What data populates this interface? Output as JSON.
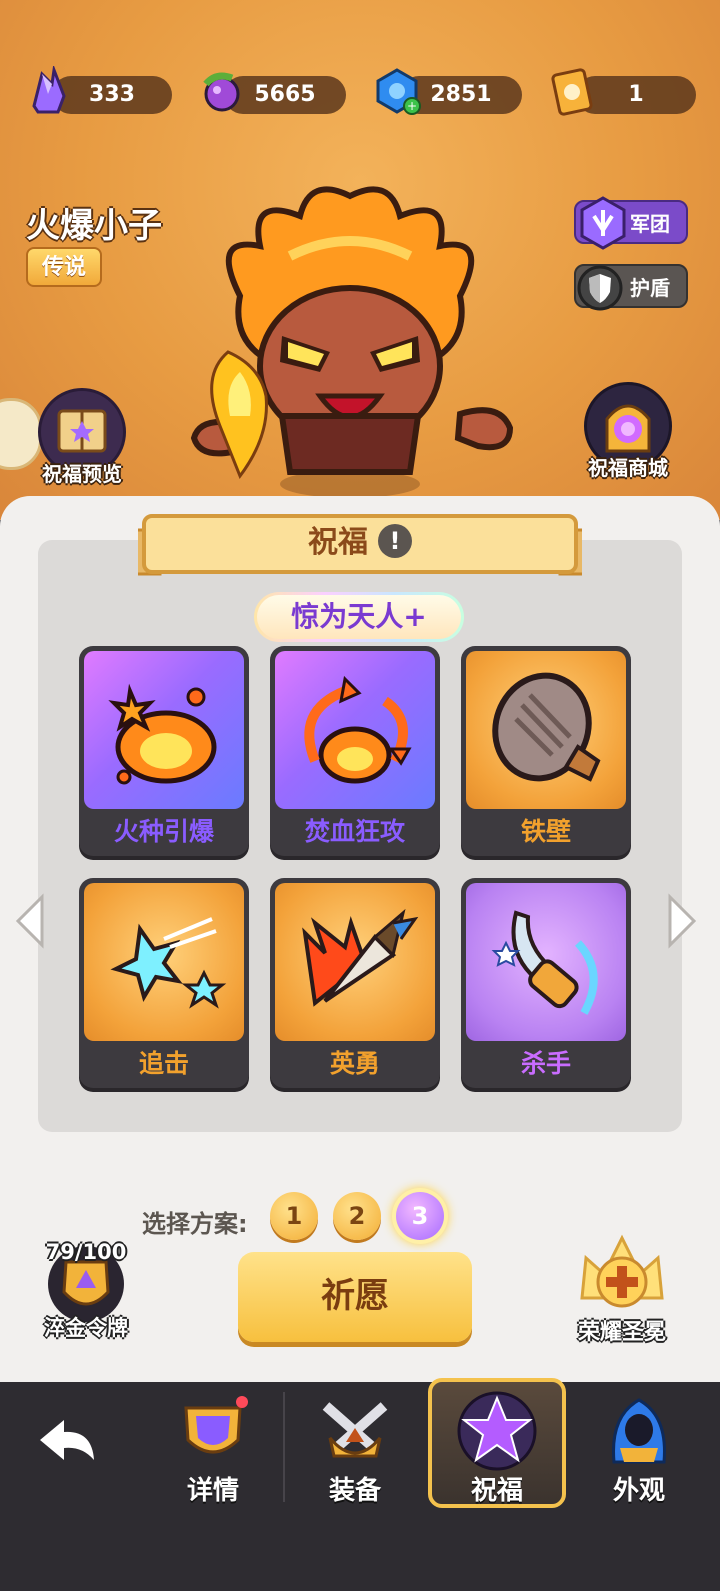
{
  "currencies": [
    {
      "icon": "crystal-icon",
      "value": "333"
    },
    {
      "icon": "potion-icon",
      "value": "5665"
    },
    {
      "icon": "blue-gem-icon",
      "value": "2851"
    },
    {
      "icon": "ticket-card-icon",
      "value": "1"
    }
  ],
  "hero": {
    "name": "火爆小子",
    "rarity": "传说"
  },
  "side_buttons": {
    "legion": "军团",
    "shield": "护盾"
  },
  "round_buttons": {
    "preview": "祝福预览",
    "shop": "祝福商城"
  },
  "blessing": {
    "title": "祝福",
    "subtitle": "惊为天人+",
    "cards": [
      {
        "name": "火种引爆",
        "rarity": "purple",
        "icon": "fire-burst-icon"
      },
      {
        "name": "焚血狂攻",
        "rarity": "purple",
        "icon": "fire-cycle-icon"
      },
      {
        "name": "铁壁",
        "rarity": "orange",
        "icon": "iron-shield-icon"
      },
      {
        "name": "追击",
        "rarity": "orange",
        "icon": "pursuit-star-icon"
      },
      {
        "name": "英勇",
        "rarity": "orange",
        "icon": "brave-arrow-icon"
      },
      {
        "name": "杀手",
        "rarity": "violet",
        "icon": "killer-blade-icon"
      }
    ]
  },
  "plans": {
    "label": "选择方案:",
    "options": [
      "1",
      "2",
      "3"
    ],
    "selected": "3"
  },
  "medal": {
    "progress": "79/100",
    "label": "淬金令牌"
  },
  "wish_button": "祈愿",
  "honor": {
    "label": "荣耀圣冕"
  },
  "nav": [
    {
      "label": "详情",
      "active": false
    },
    {
      "label": "装备",
      "active": false
    },
    {
      "label": "祝福",
      "active": true
    },
    {
      "label": "外观",
      "active": false
    }
  ],
  "colors": {
    "purple_text": "#8a5cff",
    "orange_text": "#f2a12d",
    "violet_text": "#c96cff"
  }
}
